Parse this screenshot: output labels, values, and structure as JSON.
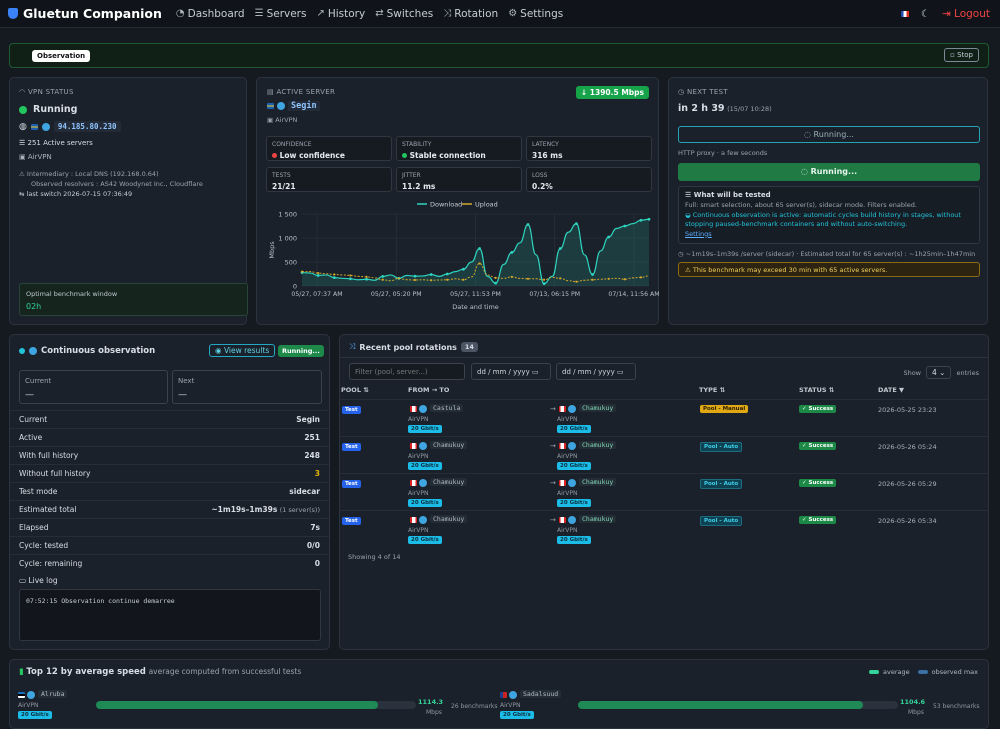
{
  "nav": {
    "brand": "Gluetun Companion",
    "links": [
      {
        "label": "Dashboard",
        "icon": "gauge-icon"
      },
      {
        "label": "Servers",
        "icon": "servers-icon"
      },
      {
        "label": "History",
        "icon": "history-icon"
      },
      {
        "label": "Switches",
        "icon": "switch-icon"
      },
      {
        "label": "Rotation",
        "icon": "shuffle-icon"
      },
      {
        "label": "Settings",
        "icon": "gear-icon"
      }
    ],
    "logout": "Logout"
  },
  "obs_bar": {
    "badge": "Observation",
    "stop": "Stop"
  },
  "vpn": {
    "title": "VPN STATUS",
    "state": "Running",
    "ip": "94.185.80.230",
    "servers": "251 Active servers",
    "provider": "AirVPN",
    "intermediary": "Intermediary : Local DNS (192.168.0.64)",
    "resolvers": "Observed resolvers : AS42 Woodynet Inc., Cloudflare",
    "last_switch": "last switch 2026-07-15 07:36:49",
    "window_title": "Optimal benchmark window",
    "window_value": "02h"
  },
  "active": {
    "title": "ACTIVE SERVER",
    "name": "Segin",
    "provider": "AirVPN",
    "speed": "↓ 1390.5 Mbps",
    "metrics": [
      {
        "t": "CONFIDENCE",
        "v": "Low confidence",
        "c": "#ef4444"
      },
      {
        "t": "STABILITY",
        "v": "Stable connection",
        "c": "#22c55e"
      },
      {
        "t": "LATENCY",
        "v": "316 ms"
      },
      {
        "t": "TESTS",
        "v": "21/21"
      },
      {
        "t": "JITTER",
        "v": "11.2 ms"
      },
      {
        "t": "LOSS",
        "v": "0.2%"
      }
    ]
  },
  "next": {
    "title": "NEXT TEST",
    "when": "in 2 h 39",
    "when_sub": "(15/07 10:28)",
    "running": "Running...",
    "proxy": "HTTP proxy · a few seconds",
    "running2": "Running...",
    "what_title": "What will be tested",
    "what_desc": "Full: smart selection, about 65 server(s), sidecar mode. Filters enabled.",
    "what_note": "Continuous observation is active: automatic cycles build history in stages, without stopping paused-benchmark containers and without auto-switching.",
    "settings_link": "Settings",
    "estimate": "~1m19s–1m39s /server (sidecar) · Estimated total for 65 server(s) : ~1h25min–1h47min",
    "warning": "This benchmark may exceed 30 min with 65 active servers."
  },
  "continuous": {
    "title": "Continuous observation",
    "view": "View results",
    "status": "Running...",
    "current_label": "Current",
    "current_value": "—",
    "next_label": "Next",
    "next_value": "—",
    "rows": [
      {
        "k": "Current",
        "v": "Segin"
      },
      {
        "k": "Active",
        "v": "251"
      },
      {
        "k": "With full history",
        "v": "248"
      },
      {
        "k": "Without full history",
        "v": "3"
      },
      {
        "k": "Test mode",
        "v": "sidecar"
      },
      {
        "k": "Estimated total",
        "v": "~1m19s–1m39s",
        "v2": "(1 server(s))"
      },
      {
        "k": "Elapsed",
        "v": "7s"
      },
      {
        "k": "Cycle: tested",
        "v": "0/0"
      },
      {
        "k": "Cycle: remaining",
        "v": "0"
      }
    ],
    "log_label": "Live log",
    "log_line": "07:52:15 Observation continue demarree"
  },
  "rotations": {
    "title": "Recent pool rotations",
    "count": "14",
    "filter_placeholder": "Filter (pool, server...)",
    "date1": "dd / mm / yyyy",
    "date2": "dd / mm / yyyy",
    "show": "Show",
    "show_value": "4",
    "entries": "entries",
    "cols": [
      "POOL ⇅",
      "FROM → TO",
      "TYPE ⇅",
      "STATUS ⇅",
      "DATE ▼"
    ],
    "rows": [
      {
        "pool": "Test",
        "from": "Castula",
        "to": "Chamukuy",
        "prov": "AirVPN",
        "gb": "20 Gbit/s",
        "type": "Pool - Manual",
        "status": "✓ Success",
        "date": "2026-05-25 23:23"
      },
      {
        "pool": "Test",
        "from": "Chamukuy",
        "to": "Chamukuy",
        "prov": "AirVPN",
        "gb": "20 Gbit/s",
        "type": "Pool - Auto",
        "status": "✓ Success",
        "date": "2026-05-26 05:24"
      },
      {
        "pool": "Test",
        "from": "Chamukuy",
        "to": "Chamukuy",
        "prov": "AirVPN",
        "gb": "20 Gbit/s",
        "type": "Pool - Auto",
        "status": "✓ Success",
        "date": "2026-05-26 05:29"
      },
      {
        "pool": "Test",
        "from": "Chamukuy",
        "to": "Chamukuy",
        "prov": "AirVPN",
        "gb": "20 Gbit/s",
        "type": "Pool - Auto",
        "status": "✓ Success",
        "date": "2026-05-26 05:34"
      }
    ],
    "footer": "Showing 4 of 14"
  },
  "top": {
    "title": "Top 12 by average speed",
    "subtitle": "average computed from successful tests",
    "legend_avg": "average",
    "legend_max": "observed max",
    "items": [
      {
        "name": "Alruba",
        "prov": "AirVPN",
        "gb": "20 Gbit/s",
        "speed": "1114.3",
        "unit": "Mbps",
        "bench": "26 benchmarks",
        "fill": 0.88
      },
      {
        "name": "Sadalsuud",
        "prov": "AirVPN",
        "gb": "20 Gbit/s",
        "speed": "1104.6",
        "unit": "Mbps",
        "bench": "53 benchmarks",
        "fill": 0.89
      }
    ]
  },
  "chart_data": {
    "type": "line",
    "xlabel": "Date and time",
    "ylabel": "Mbps",
    "ylim": [
      0,
      1500
    ],
    "yticks": [
      "1 500",
      "1 000",
      "500",
      "0"
    ],
    "xticks": [
      "05/27, 07:37 AM",
      "05/27, 05:20 PM",
      "05/27, 11:53 PM",
      "07/13, 06:15 PM",
      "07/14, 11:56 AM"
    ],
    "series": [
      {
        "name": "Download",
        "color": "#2dd4bf",
        "values": [
          280,
          270,
          220,
          230,
          175,
          160,
          150,
          130,
          140,
          120,
          200,
          230,
          160,
          220,
          205,
          210,
          240,
          200,
          250,
          300,
          350,
          500,
          780,
          200,
          60,
          450,
          700,
          900,
          1280,
          650,
          50,
          200,
          780,
          1120,
          1300,
          650,
          240,
          730,
          1020,
          1200,
          1250,
          1300,
          1370,
          1390
        ]
      },
      {
        "name": "Upload",
        "color": "#d4a72c",
        "values": [
          300,
          300,
          270,
          255,
          240,
          230,
          220,
          200,
          190,
          170,
          130,
          110,
          160,
          130,
          125,
          130,
          120,
          125,
          130,
          150,
          130,
          190,
          470,
          230,
          170,
          160,
          190,
          160,
          150,
          150,
          130,
          180,
          160,
          110,
          90,
          120,
          130,
          140,
          150,
          160,
          140,
          170,
          180,
          210
        ]
      }
    ]
  }
}
